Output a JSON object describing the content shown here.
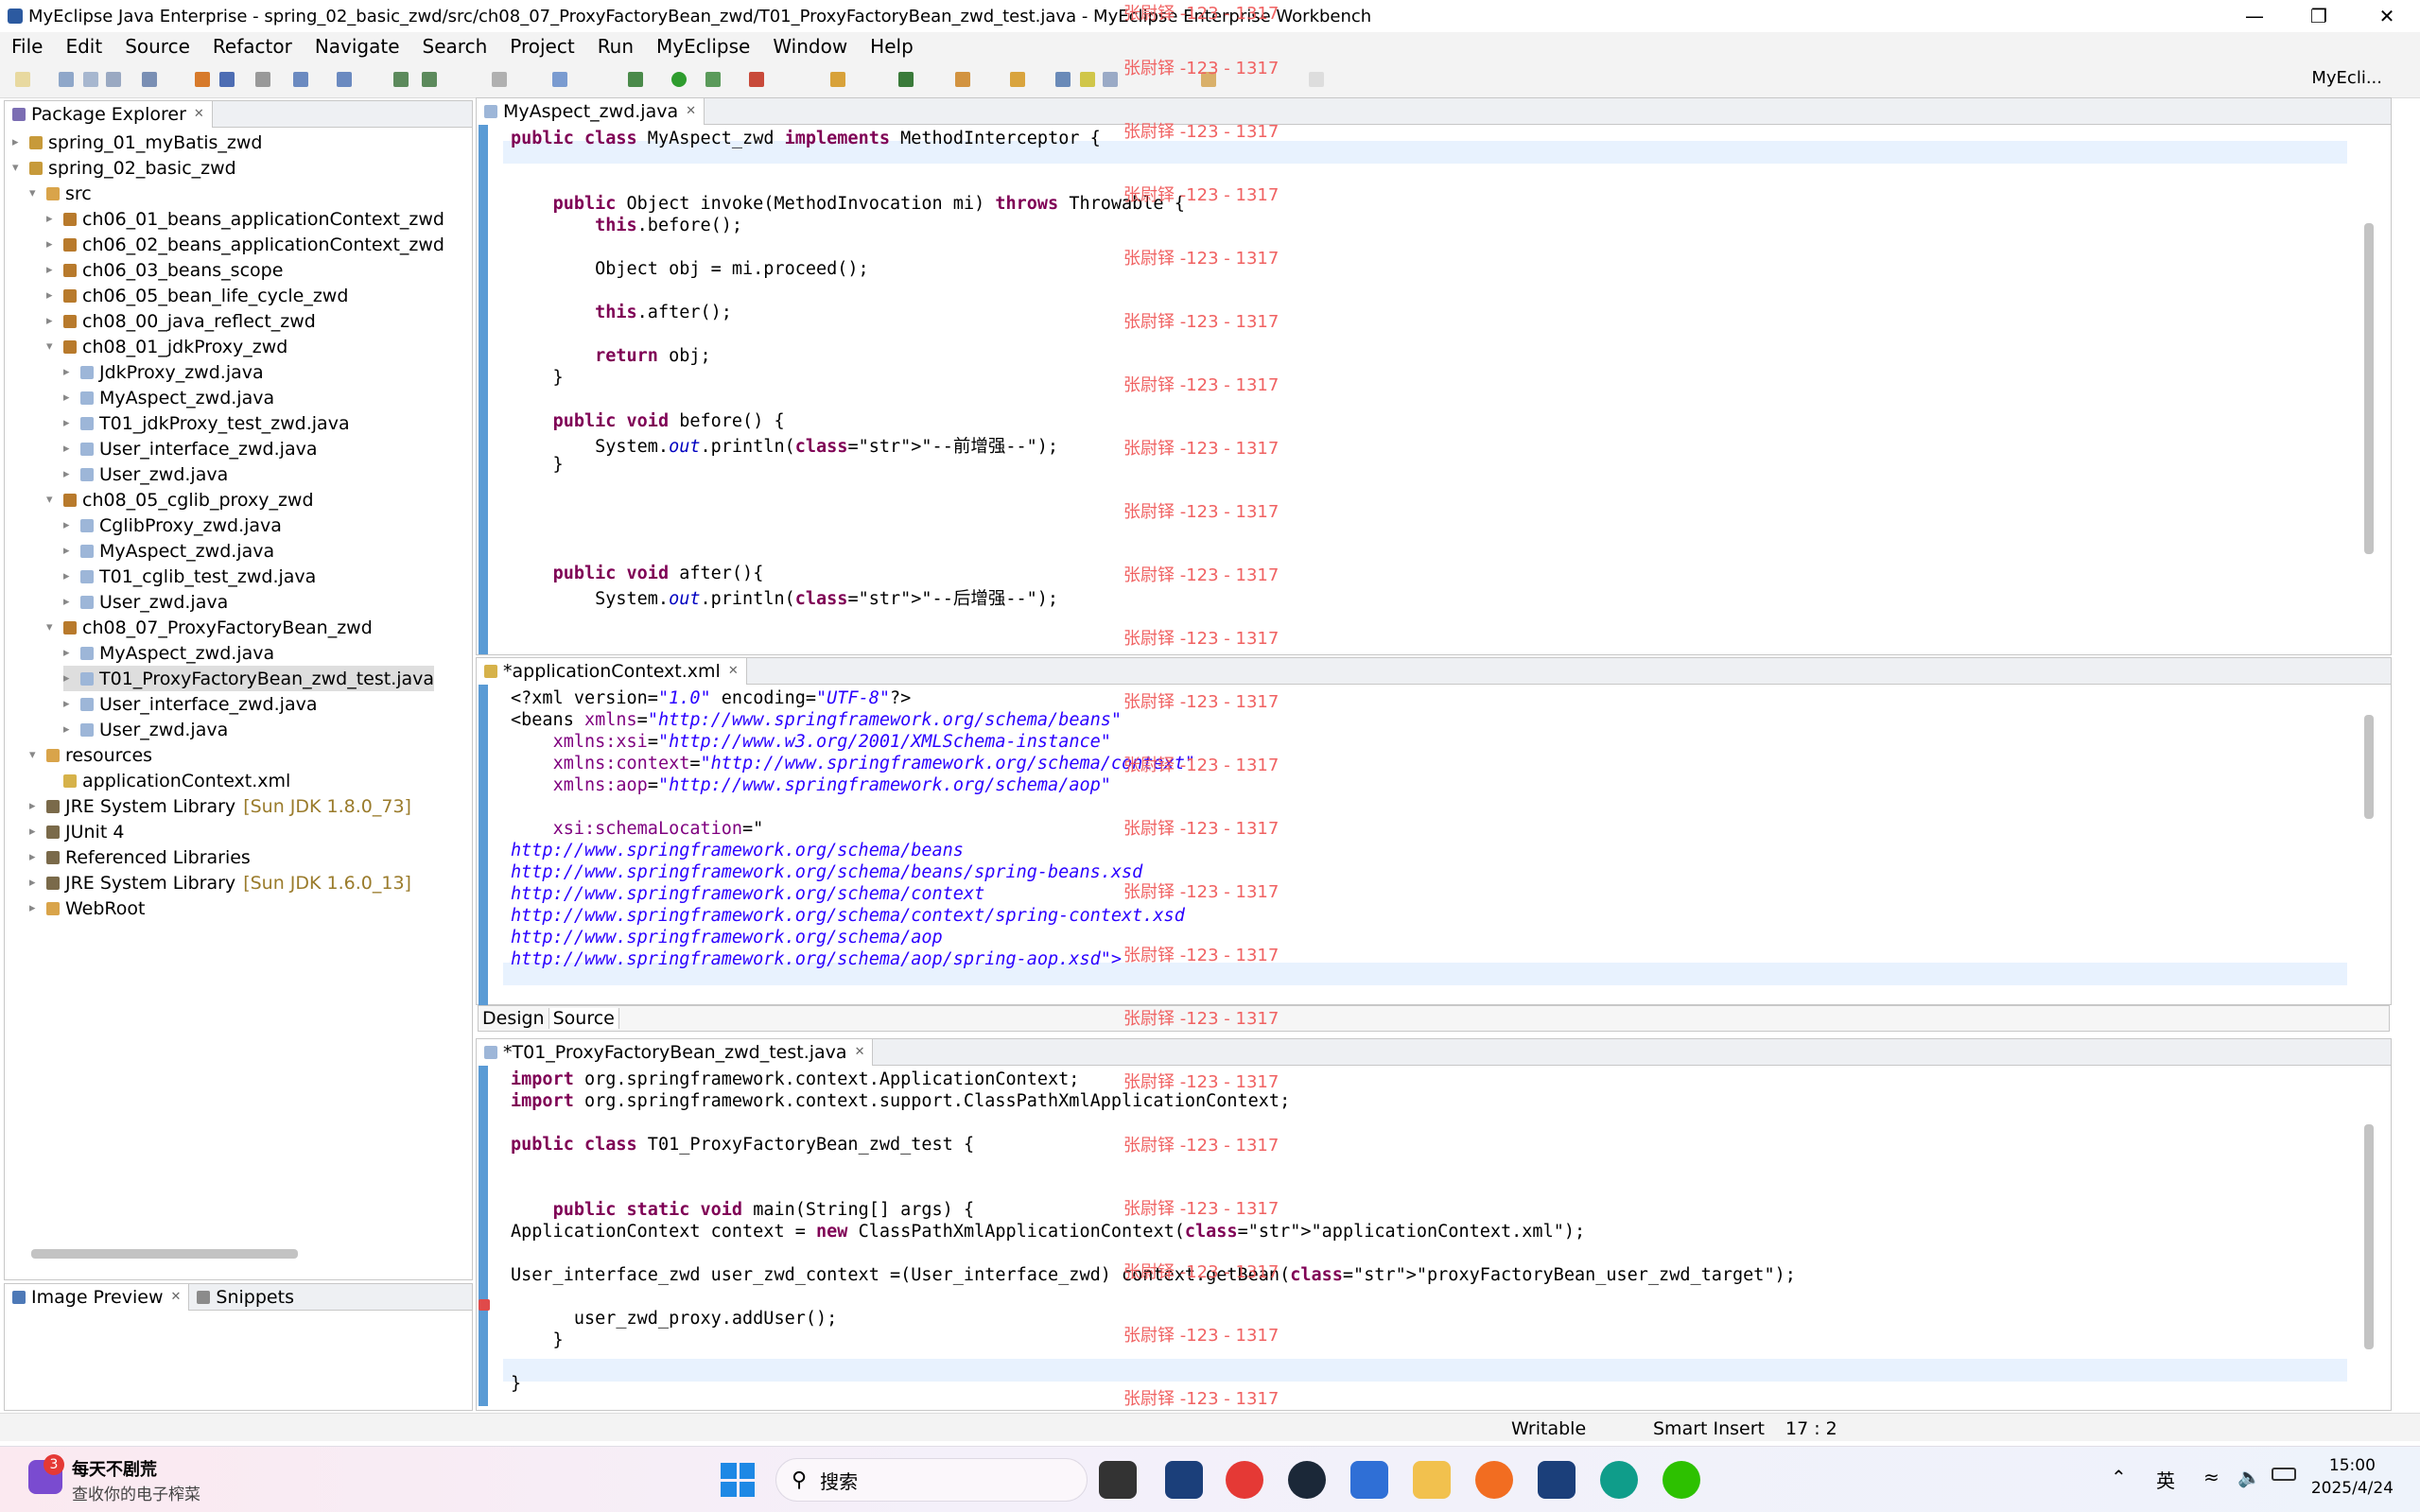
{
  "window": {
    "title": "MyEclipse Java Enterprise - spring_02_basic_zwd/src/ch08_07_ProxyFactoryBean_zwd/T01_ProxyFactoryBean_zwd_test.java - MyEclipse Enterprise Workbench"
  },
  "menu": [
    "File",
    "Edit",
    "Source",
    "Refactor",
    "Navigate",
    "Search",
    "Project",
    "Run",
    "MyEclipse",
    "Window",
    "Help"
  ],
  "perspective": "MyEcli...",
  "package_explorer": {
    "title": "Package Explorer",
    "items": [
      {
        "label": "spring_01_myBatis_zwd",
        "extra": ""
      },
      {
        "label": "spring_02_basic_zwd",
        "extra": ""
      },
      {
        "label": "src",
        "extra": ""
      },
      {
        "label": "ch06_01_beans_applicationContext_zwd",
        "extra": ""
      },
      {
        "label": "ch06_02_beans_applicationContext_zwd",
        "extra": ""
      },
      {
        "label": "ch06_03_beans_scope",
        "extra": ""
      },
      {
        "label": "ch06_05_bean_life_cycle_zwd",
        "extra": ""
      },
      {
        "label": "ch08_00_java_reflect_zwd",
        "extra": ""
      },
      {
        "label": "ch08_01_jdkProxy_zwd",
        "extra": ""
      },
      {
        "label": "JdkProxy_zwd.java",
        "extra": ""
      },
      {
        "label": "MyAspect_zwd.java",
        "extra": ""
      },
      {
        "label": "T01_jdkProxy_test_zwd.java",
        "extra": ""
      },
      {
        "label": "User_interface_zwd.java",
        "extra": ""
      },
      {
        "label": "User_zwd.java",
        "extra": ""
      },
      {
        "label": "ch08_05_cglib_proxy_zwd",
        "extra": ""
      },
      {
        "label": "CglibProxy_zwd.java",
        "extra": ""
      },
      {
        "label": "MyAspect_zwd.java",
        "extra": ""
      },
      {
        "label": "T01_cglib_test_zwd.java",
        "extra": ""
      },
      {
        "label": "User_zwd.java",
        "extra": ""
      },
      {
        "label": "ch08_07_ProxyFactoryBean_zwd",
        "extra": ""
      },
      {
        "label": "MyAspect_zwd.java",
        "extra": ""
      },
      {
        "label": "T01_ProxyFactoryBean_zwd_test.java",
        "extra": ""
      },
      {
        "label": "User_interface_zwd.java",
        "extra": ""
      },
      {
        "label": "User_zwd.java",
        "extra": ""
      },
      {
        "label": "resources",
        "extra": ""
      },
      {
        "label": "applicationContext.xml",
        "extra": ""
      },
      {
        "label": "JRE System Library",
        "extra": "[Sun JDK 1.8.0_73]"
      },
      {
        "label": "JUnit 4",
        "extra": ""
      },
      {
        "label": "Referenced Libraries",
        "extra": ""
      },
      {
        "label": "JRE System Library",
        "extra": "[Sun JDK 1.6.0_13]"
      },
      {
        "label": "WebRoot",
        "extra": ""
      }
    ]
  },
  "editor1": {
    "tab": "MyAspect_zwd.java",
    "lines": [
      "public class MyAspect_zwd implements MethodInterceptor {",
      "",
      "",
      "    public Object invoke(MethodInvocation mi) throws Throwable {",
      "        this.before();",
      "",
      "        Object obj = mi.proceed();",
      "",
      "        this.after();",
      "",
      "        return obj;",
      "    }",
      "",
      "    public void before() {",
      "        System.out.println(\"--前增强--\");",
      "    }",
      "",
      "",
      "",
      "",
      "    public void after(){",
      "        System.out.println(\"--后增强--\");"
    ]
  },
  "editor2": {
    "tab": "*applicationContext.xml",
    "lines": [
      "<?xml version=\"1.0\" encoding=\"UTF-8\"?>",
      "<beans xmlns=\"http://www.springframework.org/schema/beans\"",
      "    xmlns:xsi=\"http://www.w3.org/2001/XMLSchema-instance\"",
      "    xmlns:context=\"http://www.springframework.org/schema/context\"",
      "    xmlns:aop=\"http://www.springframework.org/schema/aop\"",
      "",
      "    xsi:schemaLocation=\"",
      "http://www.springframework.org/schema/beans",
      "http://www.springframework.org/schema/beans/spring-beans.xsd",
      "http://www.springframework.org/schema/context",
      "http://www.springframework.org/schema/context/spring-context.xsd",
      "http://www.springframework.org/schema/aop",
      "http://www.springframework.org/schema/aop/spring-aop.xsd\">"
    ],
    "design_tab": "Design",
    "source_tab": "Source"
  },
  "editor3": {
    "tab": "*T01_ProxyFactoryBean_zwd_test.java",
    "lines": [
      "import org.springframework.context.ApplicationContext;",
      "import org.springframework.context.support.ClassPathXmlApplicationContext;",
      "",
      "public class T01_ProxyFactoryBean_zwd_test {",
      "",
      "",
      "    public static void main(String[] args) {",
      "ApplicationContext context = new ClassPathXmlApplicationContext(\"applicationContext.xml\");",
      "",
      "User_interface_zwd user_zwd_context =(User_interface_zwd) context.getBean(\"proxyFactoryBean_user_zwd_target\");",
      "",
      "      user_zwd_proxy.addUser();",
      "    }",
      "",
      "}"
    ]
  },
  "watermark": "张尉铎 -123 - 1317",
  "bottom_views": {
    "image_preview": "Image Preview",
    "snippets": "Snippets"
  },
  "status": {
    "writable": "Writable",
    "insert_mode": "Smart Insert",
    "position": "17 : 2"
  },
  "taskbar": {
    "notify_title": "每天不剧荒",
    "notify_sub": "查收你的电子榨菜",
    "notify_badge": "3",
    "search_placeholder": "搜索",
    "ime": "英",
    "time": "15:00",
    "date": "2025/4/24"
  },
  "colors": {
    "keyword": "#7f0055",
    "string": "#2a00ff",
    "watermark": "#f06262",
    "accent": "#5a9bd5"
  }
}
